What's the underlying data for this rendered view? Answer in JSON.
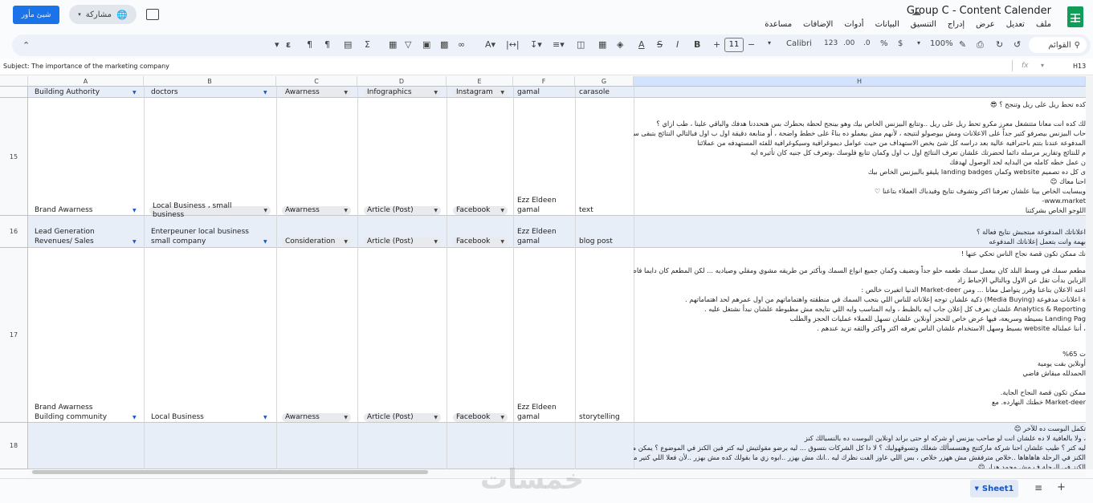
{
  "header": {
    "share_button_label": "شيئ مأور",
    "share_label": "مشاركة",
    "doc_title": "Group C - Content Calender",
    "menu": [
      "ملف",
      "تعديل",
      "عرض",
      "إدراج",
      "التنسيق",
      "البيانات",
      "أدوات",
      "الإضافات",
      "مساعدة"
    ]
  },
  "toolbar": {
    "search_placeholder": "القوائم",
    "zoom": "100%",
    "currency": "$",
    "percent": "%",
    "decimal_less": ".0",
    "decimal_more": ".00",
    "number_format": "123",
    "font_name": "Calibri",
    "font_size": "11",
    "bold": "B",
    "italic": "I"
  },
  "formula_bar": {
    "cell_ref": "H13",
    "fx": "fx",
    "content": "Subject: The importance of the marketing company"
  },
  "columns": [
    "A",
    "B",
    "C",
    "D",
    "E",
    "F",
    "G",
    "H"
  ],
  "rows": [
    {
      "num": "",
      "a": "Building Authority",
      "b": "doctors",
      "c": "Awarness",
      "d": "Infographics",
      "e": "Instagram",
      "f": "gamal",
      "g": "carasole"
    },
    {
      "num": "15",
      "a": "Brand Awarness",
      "b": "Local Business ، small business",
      "c": "Awarness",
      "d": "Article (Post)",
      "e": "Facebook",
      "f1": "Ezz Eldeen",
      "f": "gamal",
      "g": "text",
      "h": [
        "كده تحط ريل على ريل وتنجح ؟ 😎",
        "",
        "لك كده انت معانا متتشغل معرز مكرو تحط ريل على ريل ..وتتابع البيزنس الخاص بيك وهو بينجح لحظة بحطرك بس هتحددنا هدفك والباقي علينا ، طب ازاي ؟",
        "حاب البيزنس بيصرفو كتير جداً على الاعلانات ومش بيوصولو لنتيجه ، لأنهم مش بيعملو ده بناءً على خطط واضحة ، أو متابعة دقيقة اول ب اول فبالتالي النتائج بتبقى سيئه ومش",
        "المدفوعة عندنا بتتم باحترافية عالية بعد دراسه كل شئ بخص الاستهداف من حيث عوامل ديموغرافية وسيكوغرافية للفئه المستهدفه من عملائنا",
        "م للنتائج وتقارير مرسله دائما لحضرتك علشان تعرف النتائج اول ب اول وكمان تتابع فلوسك ،وتعرف كل جنيه كان تأثيره ايه",
        "ن عمل خطه كامله من البدايه لحد الوصول لهدفك",
        "ى كل ده تصميم website وكمان landing badges يليقو بالبيزنس الخاص بيك",
        "احنا معاك 😊",
        "ويبسايت الخاص بينا علشان تعرفنا اكتر وتشوف نتايج وفيدباك العملاء بتاعنا ♡",
        "www.market-",
        "اللوجو الخاص بشركتنا"
      ]
    },
    {
      "num": "16",
      "a1": "Lead Generation",
      "a": "Revenues/ Sales",
      "b1": "Enterpeuner    local business",
      "b": "small company",
      "c": "Consideration",
      "d": "Article (Post)",
      "e": "Facebook",
      "f1": "Ezz Eldeen",
      "f": "gamal",
      "g": "blog post",
      "h": [
        "اعلاناتك المدفوعة مبتجبش نتايج فعالة ؟",
        "بهمة وانت بتعمل إعلاناتك المدفوعه"
      ]
    },
    {
      "num": "17",
      "a1": "Brand Awarness",
      "a": "Building community",
      "b": "Local Business",
      "c": "Awarness",
      "d": "Article (Post)",
      "e": "Facebook",
      "f1": "Ezz Eldeen",
      "f": "gamal",
      "g": "storytelling",
      "h": [
        "نك ممكن تكون قصة نجاح الناس تحكي عنها !",
        "",
        "مطعم سمك في وسط البلد كان بيعمل سمك طعمه حلو جداً ونضيف وكمان جميع انواع السمك وبأكتر من طريقه مشوي ومقلي وصياديه ... لكن المطعم كان دايما فاضي أغلب ال",
        "الزباين بدأت تقل عن الاول وبالتالي الإحباط زاد",
        "اعته الاعلان بتاعنا وقرر يتواصل معانا ... ومن Market-deer الدنيا اتغيرت خالص :",
        "ة اعلانات مدفوعة (Media Buying) ذكية علشان توجه إعلاناته للناس اللي بتحب السمك في منطقته واهتماماتهم من اول عمرهم لحد اهتماماتهم .",
        "Analytics & Reporting علشان نعرف كل إعلان جاب ايه بالظبط ، وايه المناسب وايه اللي نتايجه مش مظبوطة علشان نبدأ نشتغل عليه .",
        "Landing Pag بسيطة وسريعة، فيها عرض خاص للحجز أونلاين علشان تسهل للعملاء عمليات الحجز والطلب",
        "، أننا عملناله website بسيط وسهل الاستخدام علشان الناس تعرفه اكتر واكتر والثقه تزيد عندهم .",
        "",
        "",
        "ت 65%",
        "أونلاين بقت يومية",
        "الحمدلله مبقاش فاضي",
        "",
        "ممكن تكون قصة النجاح الجاية.",
        "Market-deer خطتك النهارده. مع"
      ]
    },
    {
      "num": "18",
      "h": [
        "تكمل البوست ده للآخر 😊",
        "، ولا بالعافية لا ده علشان انت لو صاحب بيزنس او شركه او حتى براند اونلاين البوست ده بالنسبالك كنز",
        "ليه كتر ؟ طيب علشان احنا شركة ماركتنج وهنسسألك شغلك وتسوقهوليك ؟ لا دا كل الشركات بتسوق ... ليه برضو مقولتيش ليه كتر فين الكنز في الموضوع ؟ يمكن ملاك علشان عندنا",
        "الكنز في الرحلة هاهاهاها ..خلاص مترفقش مش ههزر خلاص ، بس اللي عاوز الفت نظرك ليه ..انك مش بهزر ..ابوه زي ما بقولك كده مش بهزر ..لأن فعلا اللي كتير ميعرفوش ف ال",
        "الكنز في الرحلة ف مش محمد هزار 😊"
      ]
    }
  ],
  "sheet_tab": "Sheet1",
  "watermark": "خمسات"
}
